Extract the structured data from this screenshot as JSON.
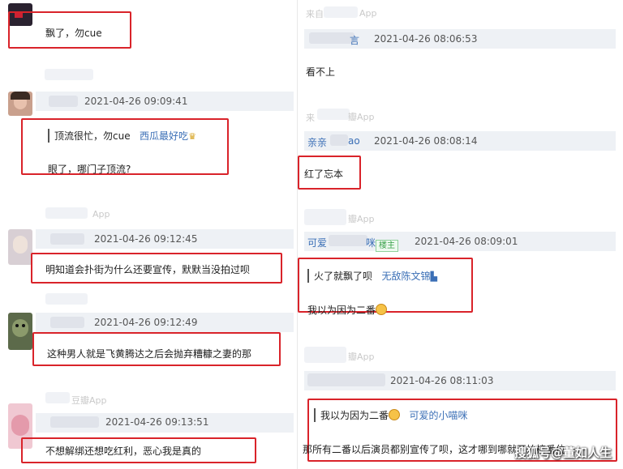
{
  "left": {
    "c1": {
      "text": "飘了，勿cue"
    },
    "c2": {
      "time": "2021-04-26 09:09:41",
      "quote": "顶流很忙，勿cue",
      "quote_user": "西瓜最好吃",
      "reply": "眼了，哪门子顶流?"
    },
    "c3": {
      "source": "App",
      "time": "2021-04-26 09:12:45",
      "text": "明知道会扑街为什么还要宣传，默默当没拍过呗"
    },
    "c4": {
      "time": "2021-04-26 09:12:49",
      "text": "这种男人就是飞黄腾达之后会抛弃糟糠之妻的那"
    },
    "c5": {
      "source": "豆瓣App",
      "time": "2021-04-26 09:13:51",
      "text": "不想解绑还想吃红利，恶心我是真的"
    }
  },
  "right": {
    "r1": {
      "source_prefix": "来自",
      "source": "App",
      "user_suffix": "言",
      "time": "2021-04-26 08:06:53",
      "text": "看不上"
    },
    "r2": {
      "source_prefix": "来",
      "source": "瓣App",
      "user": "亲亲",
      "user_suffix": "ao",
      "time": "2021-04-26 08:08:14",
      "text": "红了忘本"
    },
    "r3": {
      "source": "瓣App",
      "user": "可爱",
      "user_suffix": "咪",
      "badge": "楼主",
      "time": "2021-04-26 08:09:01",
      "quote": "火了就飘了呗",
      "quote_user": "无敌陈文锦",
      "reply": "我以为因为二番"
    },
    "r4": {
      "source": "瓣App",
      "time": "2021-04-26 08:11:03",
      "quote": "我以为因为二番",
      "quote_user": "可爱的小喵咪",
      "reply": "那所有二番以后演员都别宣传了呗，这才哪到哪就开始搞番位"
    }
  },
  "watermark": "搜狐号@董如人生",
  "colors": {
    "highlight": "#d9232a",
    "link": "#3b6fb6",
    "meta_bg": "#eef1f5"
  }
}
